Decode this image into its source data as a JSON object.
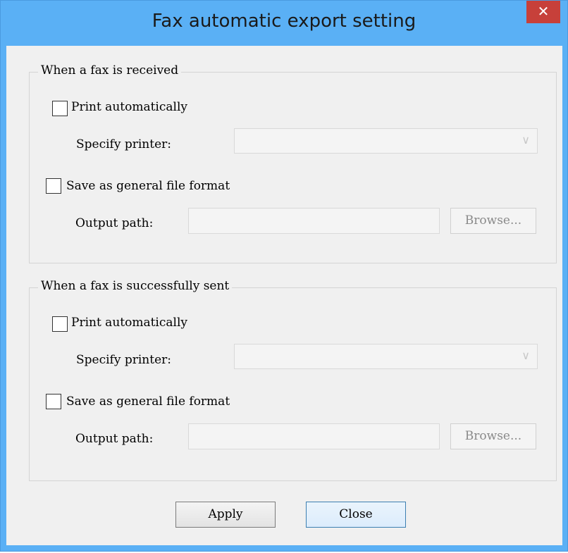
{
  "window": {
    "title": "Fax automatic export setting",
    "close_symbol": "✕"
  },
  "received": {
    "legend": "When a fax is received",
    "print_label": "Print automatically",
    "printer_label": "Specify printer:",
    "printer_value": "",
    "save_label": "Save as general file format",
    "path_label": "Output path:",
    "path_value": "",
    "browse_label": "Browse..."
  },
  "sent": {
    "legend": "When a fax is successfully sent",
    "print_label": "Print automatically",
    "printer_label": "Specify printer:",
    "printer_value": "",
    "save_label": "Save as general file format",
    "path_label": "Output path:",
    "path_value": "",
    "browse_label": "Browse..."
  },
  "buttons": {
    "apply": "Apply",
    "close": "Close"
  },
  "icons": {
    "dropdown": "chevron-down-icon",
    "close": "close-icon"
  }
}
